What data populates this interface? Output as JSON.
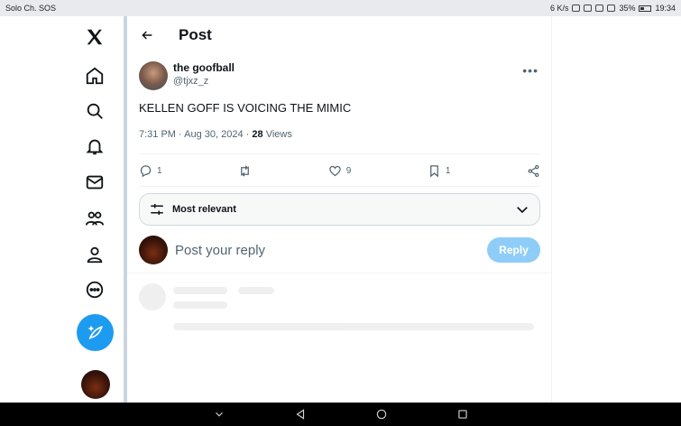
{
  "status_bar": {
    "left_text": "Solo Ch. SOS",
    "net_speed": "6 K/s",
    "battery": "35%",
    "time": "19:34"
  },
  "sidebar": {
    "icons": [
      "x-logo-icon",
      "home-icon",
      "search-icon",
      "notifications-icon",
      "messages-icon",
      "communities-icon",
      "profile-icon",
      "more-icon",
      "compose-icon"
    ]
  },
  "header": {
    "title": "Post"
  },
  "post": {
    "display_name": "the goofball",
    "handle": "@tjxz_z",
    "text": "KELLEN GOFF IS VOICING THE MIMIC",
    "timestamp": "7:31 PM · Aug 30, 2024 ·",
    "views_count": "28",
    "views_label": "Views",
    "replies": "1",
    "likes": "9",
    "bookmarks": "1"
  },
  "sort": {
    "label": "Most relevant"
  },
  "reply": {
    "placeholder": "Post your reply",
    "button": "Reply"
  },
  "colors": {
    "accent": "#1d9bf0",
    "reply_disabled": "#8ecdf7",
    "secondary_text": "#536471"
  }
}
